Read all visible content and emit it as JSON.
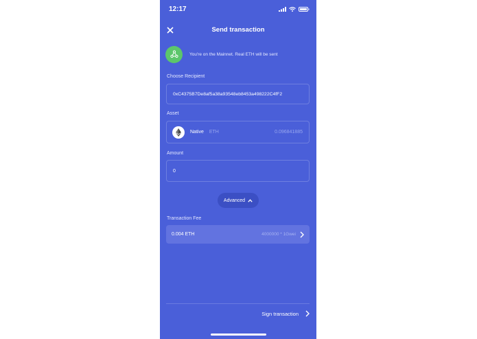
{
  "status": {
    "time": "12:17"
  },
  "header": {
    "title": "Send transaction",
    "close_icon": "close-icon"
  },
  "network": {
    "message": "You're on the Mainnet. Real ETH will be sent",
    "icon": "network-icon",
    "color": "#5cc66b"
  },
  "recipient": {
    "label": "Choose Recipient",
    "value": "0xC4375B7De8af5a38a93548eb8453a498222C4fF2"
  },
  "asset": {
    "label": "Asset",
    "name": "Native",
    "symbol": "ETH",
    "balance": "0.096841885"
  },
  "amount": {
    "label": "Amount",
    "value": "0"
  },
  "advanced": {
    "label": "Advanced"
  },
  "fee": {
    "label": "Transaction Fee",
    "value": "0.004 ETH",
    "detail": "4000000 * 1Gwei"
  },
  "footer": {
    "sign_label": "Sign transaction"
  },
  "colors": {
    "background": "#4a5fd9",
    "accent": "#5cc66b"
  }
}
